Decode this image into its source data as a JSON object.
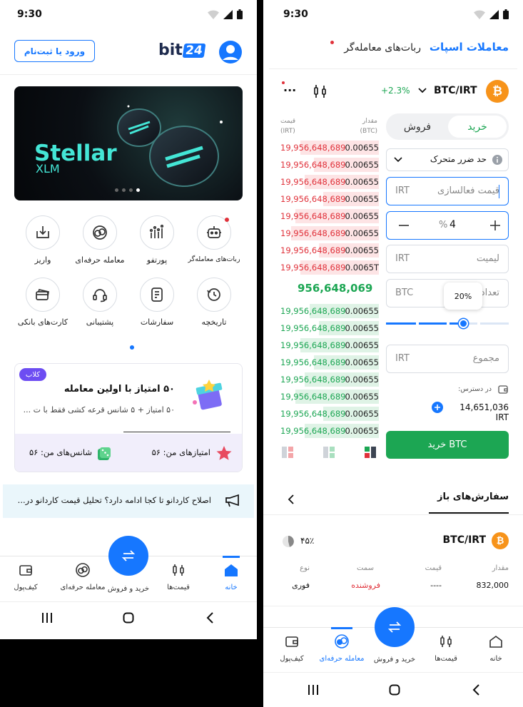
{
  "status": {
    "time": "9:30"
  },
  "left": {
    "header": {
      "login_button": "ورود یا ثبت‌نام",
      "logo_text": "bit",
      "logo_badge": "24"
    },
    "banner": {
      "title": "Stellar",
      "subtitle": "XLM"
    },
    "quick_actions": [
      {
        "label": "ربات‌های معامله‌گر",
        "icon": "robot-icon"
      },
      {
        "label": "پورتفو",
        "icon": "portfolio-icon"
      },
      {
        "label": "معامله حرفه‌ای",
        "icon": "pro-trade-icon"
      },
      {
        "label": "واریز",
        "icon": "deposit-icon"
      },
      {
        "label": "تاریخچه",
        "icon": "history-icon"
      },
      {
        "label": "سفارشات",
        "icon": "orders-icon"
      },
      {
        "label": "پشتیبانی",
        "icon": "support-icon"
      },
      {
        "label": "کارت‌های بانکی",
        "icon": "bank-card-icon"
      }
    ],
    "club": {
      "badge": "کلاب",
      "title": "۵۰ امتیاز با اولین معامله",
      "desc": "۵۰ امتیاز + ۵ شانس قرعه کشی فقط با ت ...",
      "points_label": "امتیازهای من: ۵۶",
      "chances_label": "شانس‌های من: ۵۶"
    },
    "news": {
      "text": "اصلاح کاردانو تا کجا ادامه دارد؟ تحلیل قیمت کاردانو در..."
    },
    "bottom_nav": {
      "home": "خانه",
      "prices": "قیمت‌ها",
      "buy_sell": "خرید و فروش",
      "pro_trade": "معامله حرفه‌ای",
      "wallet": "کیف‌پول"
    }
  },
  "right": {
    "tabs": {
      "spot": "معاملات اسپات",
      "bots": "ربات‌های معامله‌گر"
    },
    "pair": {
      "name": "BTC/IRT",
      "change": "+2.3%",
      "more": "..."
    },
    "orderbook": {
      "col_price": "قیمت",
      "col_price_unit": "(IRT)",
      "col_amount": "مقدار",
      "col_amount_unit": "(BTC)",
      "asks": [
        {
          "price": "19,956,648,689",
          "amount": "0.00655",
          "depth": 0.85
        },
        {
          "price": "19,956,648,689",
          "amount": "0.00655",
          "depth": 0.7
        },
        {
          "price": "19,956,648,689",
          "amount": "0.00655",
          "depth": 0.8
        },
        {
          "price": "19,956,648,689",
          "amount": "0.00655",
          "depth": 0.6
        },
        {
          "price": "19,956,648,689",
          "amount": "0.00655",
          "depth": 0.9
        },
        {
          "price": "19,956,648,689",
          "amount": "0.00655",
          "depth": 0.95
        },
        {
          "price": "19,956,648,689",
          "amount": "0.00655",
          "depth": 0.65
        },
        {
          "price": "19,956,648,689",
          "amount": "0.0065T",
          "depth": 0.85
        }
      ],
      "last_price": "956,648,069",
      "bids": [
        {
          "price": "19,956,648,689",
          "amount": "0.00655",
          "depth": 0.75
        },
        {
          "price": "19,956,648,689",
          "amount": "0.00655",
          "depth": 0.65
        },
        {
          "price": "19,956,648,689",
          "amount": "0.00655",
          "depth": 0.85
        },
        {
          "price": "19,956,648,689",
          "amount": "0.00655",
          "depth": 0.7
        },
        {
          "price": "19,956,648,689",
          "amount": "0.00655",
          "depth": 0.8
        },
        {
          "price": "19,956,648,689",
          "amount": "0.00655",
          "depth": 0.9
        },
        {
          "price": "19,956,648,689",
          "amount": "0.00655",
          "depth": 0.6
        },
        {
          "price": "19,956,648,689",
          "amount": "0.00655",
          "depth": 0.8
        }
      ]
    },
    "form": {
      "buy_tab": "خرید",
      "sell_tab": "فروش",
      "order_type": "حد ضرر متحرک",
      "activation_placeholder": "قیمت فعالسازی",
      "activation_unit": "IRT",
      "percent_value": "4",
      "percent_sign": "%",
      "limit_placeholder": "لیمیت",
      "limit_unit": "IRT",
      "amount_placeholder": "تعداد",
      "amount_unit": "BTC",
      "slider_tooltip": "20%",
      "slider_value": 0.2,
      "total_placeholder": "مجموع",
      "total_unit": "IRT",
      "available_label": "در دسترس:",
      "available_value": "14,651,036 IRT",
      "submit": "خرید BTC"
    },
    "open_orders": {
      "title": "سفارش‌های باز",
      "pair": "BTC/IRT",
      "percent": "۴۵٪",
      "headers": {
        "amount": "مقدار",
        "price": "قیمت",
        "side": "سمت",
        "type": "نوع"
      },
      "row": {
        "amount": "832,000",
        "price": "----",
        "side": "فروشنده",
        "type": "فوری"
      }
    },
    "bottom_nav": {
      "home": "خانه",
      "prices": "قیمت‌ها",
      "buy_sell": "خرید و فروش",
      "pro_trade": "معامله حرفه‌ای",
      "wallet": "کیف‌پول"
    }
  },
  "colors": {
    "accent": "#1677ff",
    "buy": "#1ca653",
    "sell": "#e0313a",
    "club": "#6d4df2"
  }
}
